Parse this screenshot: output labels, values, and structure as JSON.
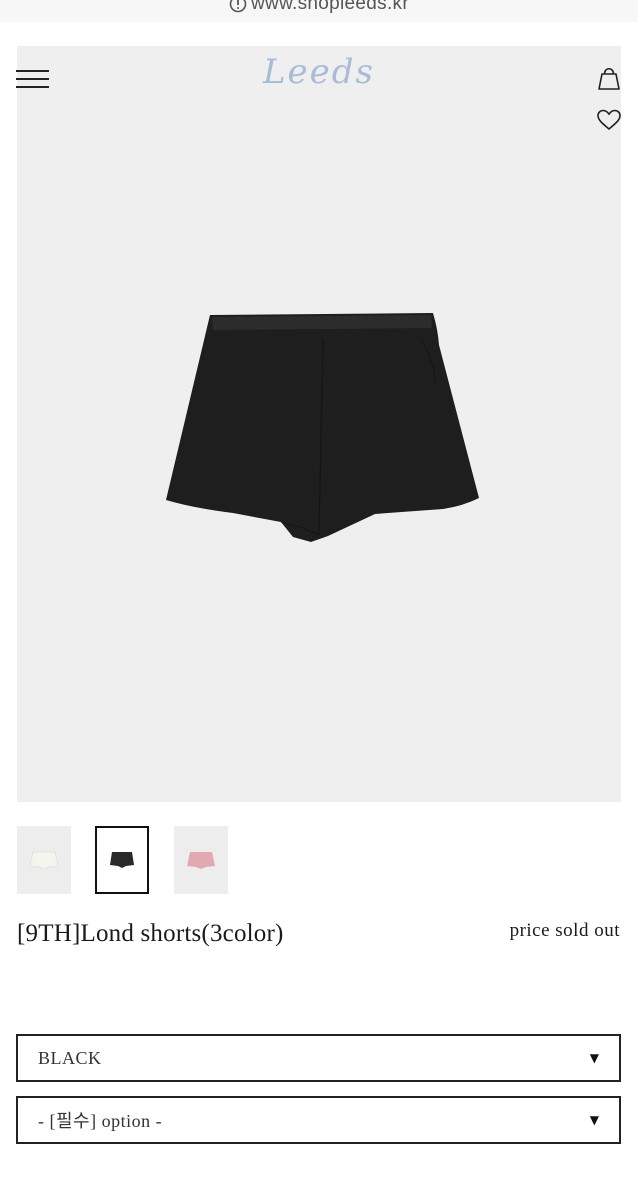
{
  "browser": {
    "url": "www.shopleeds.kr",
    "info_icon": "info-circle-icon"
  },
  "header": {
    "logo_text": "Leeds",
    "menu_icon": "hamburger-menu-icon",
    "cart_icon": "shopping-bag-icon",
    "wishlist_icon": "heart-icon"
  },
  "gallery": {
    "main_image": "black-shorts-photo",
    "background_color": "#efefef",
    "thumbnails": [
      {
        "color": "ivory",
        "fill": "#f6f4ee",
        "selected": false
      },
      {
        "color": "black",
        "fill": "#2a2a2a",
        "selected": true
      },
      {
        "color": "pink",
        "fill": "#e3a9b2",
        "selected": false
      }
    ]
  },
  "product": {
    "title": "[9TH]Lond shorts(3color)",
    "price_status": "price sold out"
  },
  "options": {
    "color_select": {
      "value": "BLACK"
    },
    "option_select": {
      "value": "- [필수] option -"
    },
    "arrow_glyph": "▼"
  },
  "colors": {
    "logo": "#a8bcd8",
    "border": "#222222"
  }
}
